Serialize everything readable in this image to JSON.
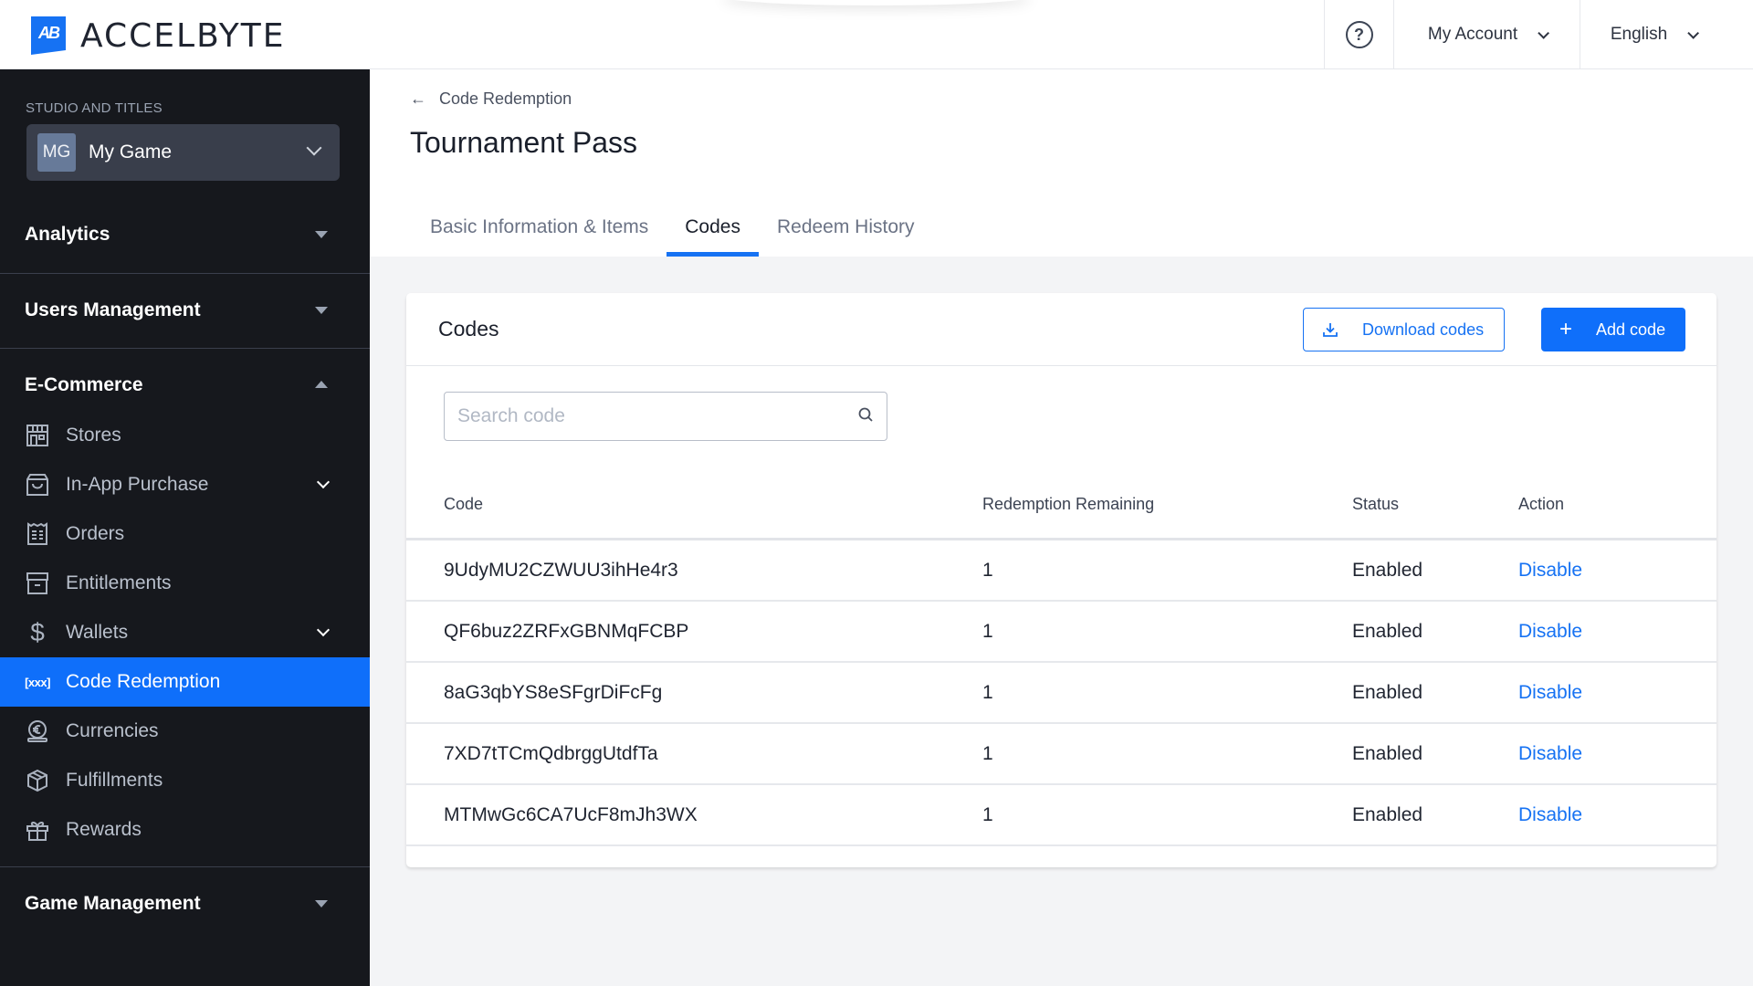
{
  "header": {
    "brand": "ACCELBYTE",
    "logo_mark": "AB",
    "help_icon": "question-circle-icon",
    "account_label": "My Account",
    "language_label": "English"
  },
  "sidebar": {
    "studio_label": "STUDIO AND TITLES",
    "studio": {
      "badge": "MG",
      "name": "My Game"
    },
    "sections": [
      {
        "label": "Analytics",
        "expanded": false
      },
      {
        "label": "Users Management",
        "expanded": false
      },
      {
        "label": "E-Commerce",
        "expanded": true
      },
      {
        "label": "Game Management",
        "expanded": false
      }
    ],
    "ecommerce_items": [
      {
        "label": "Stores",
        "icon": "store-icon",
        "has_submenu": false,
        "active": false
      },
      {
        "label": "In-App Purchase",
        "icon": "shopping-bag-icon",
        "has_submenu": true,
        "active": false
      },
      {
        "label": "Orders",
        "icon": "receipt-icon",
        "has_submenu": false,
        "active": false
      },
      {
        "label": "Entitlements",
        "icon": "archive-box-icon",
        "has_submenu": false,
        "active": false
      },
      {
        "label": "Wallets",
        "icon": "dollar-icon",
        "has_submenu": true,
        "active": false
      },
      {
        "label": "Code Redemption",
        "icon": "code-brackets-icon",
        "has_submenu": false,
        "active": true
      },
      {
        "label": "Currencies",
        "icon": "euro-coin-icon",
        "has_submenu": false,
        "active": false
      },
      {
        "label": "Fulfillments",
        "icon": "package-icon",
        "has_submenu": false,
        "active": false
      },
      {
        "label": "Rewards",
        "icon": "gift-icon",
        "has_submenu": false,
        "active": false
      }
    ]
  },
  "page": {
    "breadcrumb": "Code Redemption",
    "title": "Tournament Pass",
    "tabs": [
      {
        "label": "Basic Information & Items",
        "active": false
      },
      {
        "label": "Codes",
        "active": true
      },
      {
        "label": "Redeem History",
        "active": false
      }
    ]
  },
  "codes_card": {
    "title": "Codes",
    "download_label": "Download codes",
    "add_label": "Add code",
    "search": {
      "placeholder": "Search code",
      "value": ""
    },
    "columns": [
      "Code",
      "Redemption Remaining",
      "Status",
      "Action"
    ],
    "rows": [
      {
        "code": "9UdyMU2CZWUU3ihHe4r3",
        "remaining": "1",
        "status": "Enabled",
        "action": "Disable"
      },
      {
        "code": "QF6buz2ZRFxGBNMqFCBP",
        "remaining": "1",
        "status": "Enabled",
        "action": "Disable"
      },
      {
        "code": "8aG3qbYS8eSFgrDiFcFg",
        "remaining": "1",
        "status": "Enabled",
        "action": "Disable"
      },
      {
        "code": "7XD7tTCmQdbrggUtdfTa",
        "remaining": "1",
        "status": "Enabled",
        "action": "Disable"
      },
      {
        "code": "MTMwGc6CA7UcF8mJh3WX",
        "remaining": "1",
        "status": "Enabled",
        "action": "Disable"
      }
    ]
  },
  "colors": {
    "accent": "#1672f3",
    "sidebar_bg": "#16181d",
    "active_item_bg": "#0f6ffa",
    "page_bg": "#f3f4f6"
  }
}
